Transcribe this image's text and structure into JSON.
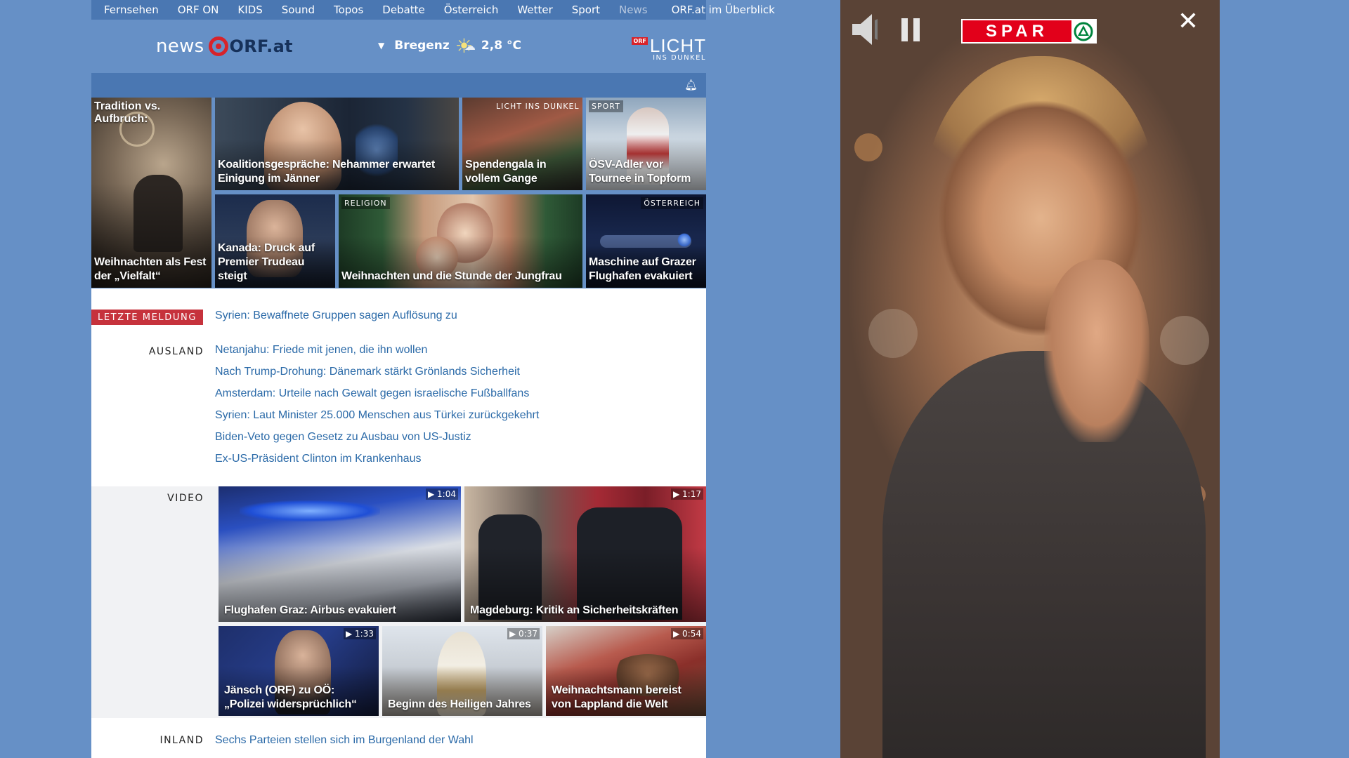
{
  "topnav": {
    "items": [
      "Fernsehen",
      "ORF ON",
      "KIDS",
      "Sound",
      "Topos",
      "Debatte",
      "Österreich",
      "Wetter",
      "Sport",
      "News"
    ],
    "overview": "ORF.at im Überblick"
  },
  "header": {
    "logo_news": "news",
    "logo_orfat": "ORF.at",
    "weather_location": "Bregenz",
    "weather_temp": "2,8 °C",
    "lid_badge": "ORF",
    "lid_title": "LICHT",
    "lid_sub": "INS DUNKEL"
  },
  "tiles": {
    "tradition": {
      "top": "Tradition vs. Aufbruch:",
      "title": "Weihnachten als Fest der „Vielfalt“"
    },
    "koalition": {
      "title": "Koalitionsgespräche: Nehammer erwartet Einigung im Jänner"
    },
    "spenden": {
      "tag": "LICHT INS DUNKEL",
      "title": "Spendengala in vollem Gange"
    },
    "oesv": {
      "tag": "SPORT",
      "title": "ÖSV-Adler vor Tournee in Topform"
    },
    "kanada": {
      "title": "Kanada: Druck auf Premier Trudeau steigt"
    },
    "religion": {
      "tag": "RELIGION",
      "title": "Weihnachten und die Stunde der Jungfrau"
    },
    "maschine": {
      "tag": "ÖSTERREICH",
      "title": "Maschine auf Grazer Flughafen evakuiert"
    }
  },
  "news": {
    "lm_label": "LETZTE MELDUNG",
    "lm_text": "Syrien: Bewaffnete Gruppen sagen Auflösung zu",
    "ausland_label": "AUSLAND",
    "ausland": [
      "Netanjahu: Friede mit jenen, die ihn wollen",
      "Nach Trump-Drohung: Dänemark stärkt Grönlands Sicherheit",
      "Amsterdam: Urteile nach Gewalt gegen israelische Fußballfans",
      "Syrien: Laut Minister 25.000 Menschen aus Türkei zurückgekehrt",
      "Biden-Veto gegen Gesetz zu Ausbau von US-Justiz",
      "Ex-US-Präsident Clinton im Krankenhaus"
    ],
    "video_label": "VIDEO",
    "inland_label": "INLAND",
    "inland_first": "Sechs Parteien stellen sich im Burgenland der Wahl"
  },
  "videos": [
    {
      "title": "Flughafen Graz: Airbus evakuiert",
      "duration": "1:04"
    },
    {
      "title": "Magdeburg: Kritik an Sicherheitskräften",
      "duration": "1:17"
    },
    {
      "title": "Jänsch (ORF) zu OÖ: „Polizei widersprüchlich“",
      "duration": "1:33"
    },
    {
      "title": "Beginn des Heiligen Jahres",
      "duration": "0:37"
    },
    {
      "title": "Weihnachtsmann bereist von Lappland die Welt",
      "duration": "0:54"
    }
  ],
  "ad": {
    "brand": "SPAR",
    "icons": [
      "speaker-icon",
      "pause-icon",
      "close-icon"
    ]
  },
  "colors": {
    "page_bg": "#6690c6",
    "nav_bg": "#4a77b2",
    "link": "#2b6aa8",
    "alert": "#c6323c",
    "spar_red": "#e2001a"
  }
}
